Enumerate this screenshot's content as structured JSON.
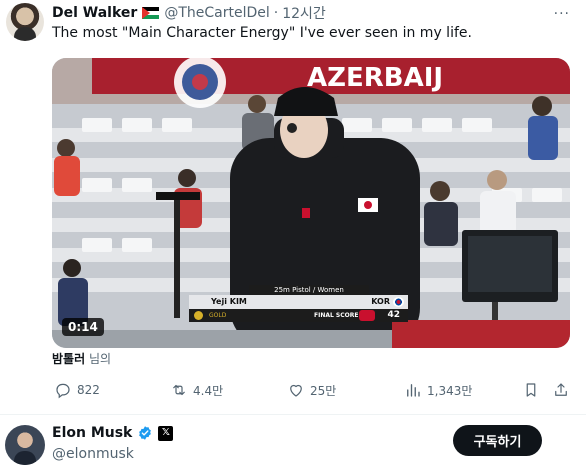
{
  "tweet": {
    "author_name": "Del Walker",
    "author_handle": "@TheCartelDel",
    "separator": "·",
    "time": "12시간",
    "more_label": "···",
    "text": "The most \"Main Character Energy\" I've ever seen in my life.",
    "media": {
      "duration": "0:14",
      "banner_text": "AZERBAIJ",
      "scoreboard": {
        "event": "25m Pistol / Women",
        "athlete": "Yeji KIM",
        "country": "KOR",
        "medal": "GOLD",
        "score_label": "FINAL SCORE",
        "score": "42"
      }
    },
    "from_user": "밤톨러",
    "from_suffix": "님의",
    "actions": {
      "replies": "822",
      "retweets": "4.4만",
      "likes": "25만",
      "views": "1,343만"
    }
  },
  "recommended_user": {
    "name": "Elon Musk",
    "handle": "@elonmusk",
    "badge_letter": "𝕏",
    "follow_label": "구독하기"
  },
  "colors": {
    "text_primary": "#0f1419",
    "text_secondary": "#536471",
    "verified_blue": "#1d9bf0",
    "button_bg": "#0f1419"
  }
}
